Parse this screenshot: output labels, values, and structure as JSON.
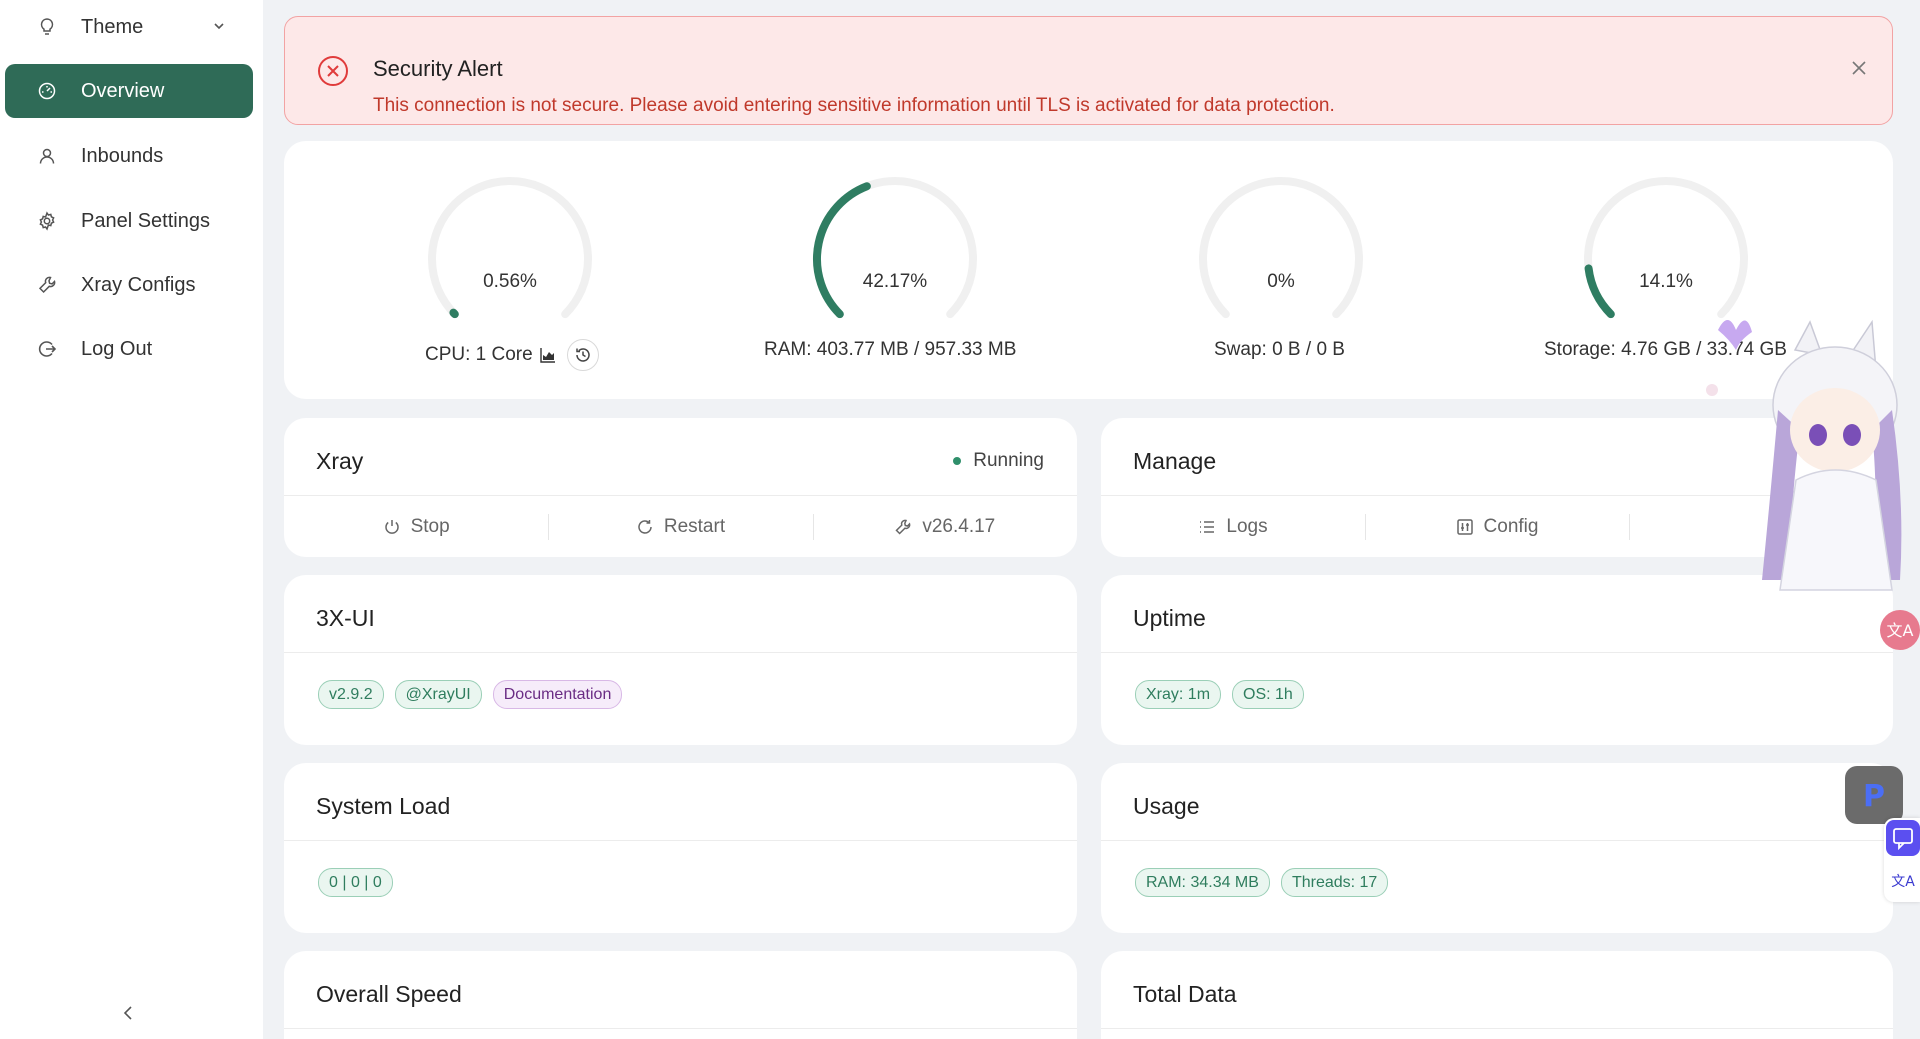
{
  "sidebar": {
    "items": [
      {
        "label": "Theme"
      },
      {
        "label": "Overview"
      },
      {
        "label": "Inbounds"
      },
      {
        "label": "Panel Settings"
      },
      {
        "label": "Xray Configs"
      },
      {
        "label": "Log Out"
      }
    ]
  },
  "alert": {
    "title": "Security Alert",
    "message": "This connection is not secure. Please avoid entering sensitive information until TLS is activated for data protection."
  },
  "gauges": [
    {
      "value": "0.56%",
      "percent": 0.56,
      "caption": "CPU: 1 Core"
    },
    {
      "value": "42.17%",
      "percent": 42.17,
      "caption": "RAM: 403.77 MB / 957.33 MB"
    },
    {
      "value": "0%",
      "percent": 0,
      "caption": "Swap: 0 B / 0 B"
    },
    {
      "value": "14.1%",
      "percent": 14.1,
      "caption": "Storage: 4.76 GB / 33.74 GB"
    }
  ],
  "xray": {
    "title": "Xray",
    "status": "Running",
    "actions": {
      "stop": "Stop",
      "restart": "Restart",
      "version": "v26.4.17"
    }
  },
  "manage": {
    "title": "Manage",
    "actions": {
      "logs": "Logs",
      "config": "Config"
    }
  },
  "panel": {
    "title": "3X-UI",
    "tags": {
      "version": "v2.9.2",
      "handle": "@XrayUI",
      "docs": "Documentation"
    }
  },
  "uptime": {
    "title": "Uptime",
    "tags": {
      "xray": "Xray: 1m",
      "os": "OS: 1h"
    }
  },
  "system_load": {
    "title": "System Load",
    "tags": {
      "load": "0 | 0 | 0"
    }
  },
  "usage": {
    "title": "Usage",
    "tags": {
      "ram": "RAM: 34.34 MB",
      "threads": "Threads: 17"
    }
  },
  "overall_speed": {
    "title": "Overall Speed"
  },
  "total_data": {
    "title": "Total Data"
  },
  "colors": {
    "accent": "#2f6b57",
    "gauge_track": "#f0f0f0",
    "gauge_fill": "#2f7d62",
    "alert_bg": "#fde8e8",
    "alert_text": "#c0392b"
  }
}
